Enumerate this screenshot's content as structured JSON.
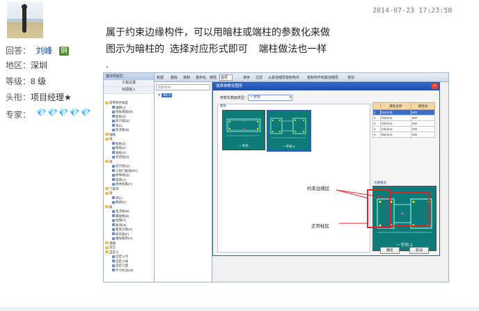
{
  "timestamp": "2014-07-23 17:23:50",
  "user": {
    "reply_label": "回答：",
    "name": "刘峰",
    "badge": "铜",
    "region_label": "地区：",
    "region": "深圳",
    "level_label": "等级：",
    "level": "8 级",
    "title_label": "头衔：",
    "title": "项目经理★",
    "expert_label": "专家：",
    "gems": "💎💎💎💎💎"
  },
  "post": {
    "line1": "属于约束边缘构件，可以用暗柱或端柱的参数化来做",
    "line2": "图示为暗柱的  选择对应形式即可    端柱做法也一样",
    "line3": "."
  },
  "software": {
    "left_panel_title": "模块导航栏",
    "btn_project_settings": "工程设置",
    "btn_drawing_input": "绘图输入",
    "toolbar": [
      "新建",
      "删除",
      "复制",
      "重命名",
      "楼层",
      "首层",
      "排序",
      "过滤",
      "从其他楼层复制构件",
      "复制构件到其他楼层",
      "查找"
    ],
    "floor_value": "首层",
    "search_placeholder": "搜索构件...",
    "selected_item": "AZ-1",
    "tree": [
      {
        "label": "常用构件类型",
        "folder": true
      },
      {
        "label": "轴网(J)",
        "folder": false
      },
      {
        "label": "筏板基础(M)",
        "folder": false
      },
      {
        "label": "框柱(Z)",
        "folder": false
      },
      {
        "label": "剪力墙(Q)",
        "folder": false
      },
      {
        "label": "梁(L)",
        "folder": false
      },
      {
        "label": "现浇板(B)",
        "folder": false
      },
      {
        "label": "轴线",
        "folder": true
      },
      {
        "label": "柱",
        "folder": true
      },
      {
        "label": "框柱(Z)",
        "folder": false
      },
      {
        "label": "暗柱(Z)",
        "folder": false
      },
      {
        "label": "端柱(Z)",
        "folder": false
      },
      {
        "label": "构造柱(Z)",
        "folder": false
      },
      {
        "label": "墙",
        "folder": true
      },
      {
        "label": "剪力墙(Q)",
        "folder": false
      },
      {
        "label": "人防门框墙(RF)",
        "folder": false
      },
      {
        "label": "砌体墙(Q)",
        "folder": false
      },
      {
        "label": "暗梁(A)",
        "folder": false
      },
      {
        "label": "砌体加筋(Y)",
        "folder": false
      },
      {
        "label": "门窗洞",
        "folder": true
      },
      {
        "label": "梁",
        "folder": true
      },
      {
        "label": "梁(L)",
        "folder": false
      },
      {
        "label": "圈梁(E)",
        "folder": false
      },
      {
        "label": "板",
        "folder": true
      },
      {
        "label": "现浇板(B)",
        "folder": false
      },
      {
        "label": "螺旋板(B)",
        "folder": false
      },
      {
        "label": "柱帽(V)",
        "folder": false
      },
      {
        "label": "板洞(N)",
        "folder": false
      },
      {
        "label": "板受力筋(S)",
        "folder": false
      },
      {
        "label": "板负筋(F)",
        "folder": false
      },
      {
        "label": "楼层板带(H)",
        "folder": false
      },
      {
        "label": "基础",
        "folder": true
      },
      {
        "label": "其它",
        "folder": true
      },
      {
        "label": "自定义",
        "folder": true
      },
      {
        "label": "自定义点",
        "folder": false
      },
      {
        "label": "自定义线",
        "folder": false
      },
      {
        "label": "自定义面",
        "folder": false
      },
      {
        "label": "尺寸标注(W)",
        "folder": false
      }
    ],
    "dialog": {
      "title": "选择参数化图形",
      "type_label": "参数化截面类型：",
      "type_value": "一字形",
      "group_label": "图形",
      "thumb1_label": "一字形",
      "thumb2_label": "一字形-1",
      "table_headers": [
        "属性名称",
        "属性值"
      ],
      "table_rows": [
        [
          "1",
          "b1(mm)",
          "400"
        ],
        [
          "2",
          "b2(mm)",
          "200"
        ],
        [
          "3",
          "b3(mm)",
          "200"
        ],
        [
          "4",
          "b4(mm)",
          "200"
        ],
        [
          "5",
          "b5(mm)",
          "200"
        ]
      ],
      "preview_label": "大图预览",
      "preview_caption": "一字形-1",
      "callout_constraint": "约束边缘区",
      "callout_normal": "正常柱区",
      "ok": "确定",
      "cancel": "取消"
    }
  }
}
